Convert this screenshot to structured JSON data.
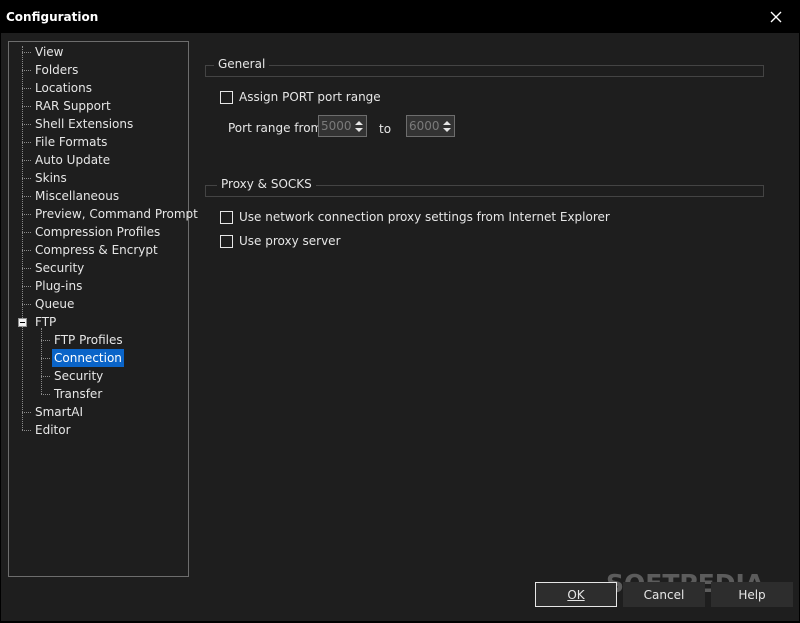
{
  "window": {
    "title": "Configuration"
  },
  "tree": {
    "items": [
      {
        "label": "View"
      },
      {
        "label": "Folders"
      },
      {
        "label": "Locations"
      },
      {
        "label": "RAR Support"
      },
      {
        "label": "Shell Extensions"
      },
      {
        "label": "File Formats"
      },
      {
        "label": "Auto Update"
      },
      {
        "label": "Skins"
      },
      {
        "label": "Miscellaneous"
      },
      {
        "label": "Preview, Command Prompt"
      },
      {
        "label": "Compression Profiles"
      },
      {
        "label": "Compress & Encrypt"
      },
      {
        "label": "Security"
      },
      {
        "label": "Plug-ins"
      },
      {
        "label": "Queue"
      },
      {
        "label": "FTP",
        "expanded": true
      },
      {
        "label": "FTP Profiles",
        "child": true
      },
      {
        "label": "Connection",
        "child": true,
        "selected": true
      },
      {
        "label": "Security",
        "child": true
      },
      {
        "label": "Transfer",
        "child": true
      },
      {
        "label": "SmartAI"
      },
      {
        "label": "Editor"
      }
    ]
  },
  "general": {
    "heading": "General",
    "assign_port_label": "Assign PORT port range",
    "assign_port_checked": false,
    "port_range_from_label": "Port range from:",
    "port_from_value": "5000",
    "to_label": "to",
    "port_to_value": "6000"
  },
  "proxy": {
    "heading": "Proxy & SOCKS",
    "use_ie_proxy_label": "Use network connection proxy settings from Internet Explorer",
    "use_ie_proxy_checked": false,
    "use_proxy_server_label": "Use proxy server",
    "use_proxy_server_checked": false
  },
  "buttons": {
    "ok_label": "OK",
    "cancel_label": "Cancel",
    "help_label": "Help"
  },
  "watermark": "SOFTPEDIA",
  "colors": {
    "selection": "#0a64c8",
    "background": "#1e1e1e",
    "titlebar": "#000000"
  }
}
